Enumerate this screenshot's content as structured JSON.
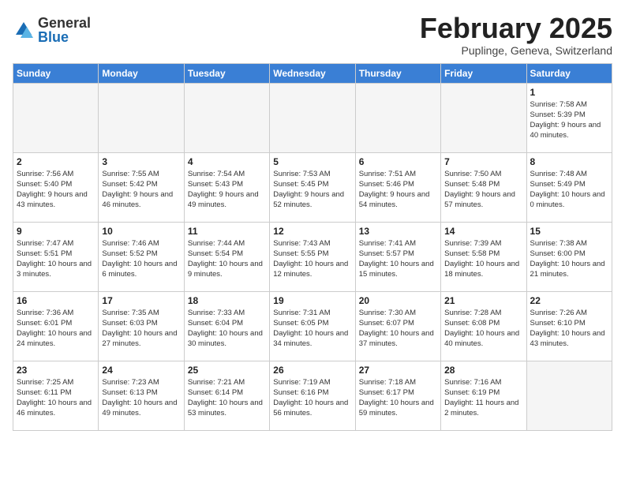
{
  "header": {
    "logo_general": "General",
    "logo_blue": "Blue",
    "month_title": "February 2025",
    "location": "Puplinge, Geneva, Switzerland"
  },
  "weekdays": [
    "Sunday",
    "Monday",
    "Tuesday",
    "Wednesday",
    "Thursday",
    "Friday",
    "Saturday"
  ],
  "weeks": [
    [
      {
        "day": "",
        "info": ""
      },
      {
        "day": "",
        "info": ""
      },
      {
        "day": "",
        "info": ""
      },
      {
        "day": "",
        "info": ""
      },
      {
        "day": "",
        "info": ""
      },
      {
        "day": "",
        "info": ""
      },
      {
        "day": "1",
        "info": "Sunrise: 7:58 AM\nSunset: 5:39 PM\nDaylight: 9 hours and 40 minutes."
      }
    ],
    [
      {
        "day": "2",
        "info": "Sunrise: 7:56 AM\nSunset: 5:40 PM\nDaylight: 9 hours and 43 minutes."
      },
      {
        "day": "3",
        "info": "Sunrise: 7:55 AM\nSunset: 5:42 PM\nDaylight: 9 hours and 46 minutes."
      },
      {
        "day": "4",
        "info": "Sunrise: 7:54 AM\nSunset: 5:43 PM\nDaylight: 9 hours and 49 minutes."
      },
      {
        "day": "5",
        "info": "Sunrise: 7:53 AM\nSunset: 5:45 PM\nDaylight: 9 hours and 52 minutes."
      },
      {
        "day": "6",
        "info": "Sunrise: 7:51 AM\nSunset: 5:46 PM\nDaylight: 9 hours and 54 minutes."
      },
      {
        "day": "7",
        "info": "Sunrise: 7:50 AM\nSunset: 5:48 PM\nDaylight: 9 hours and 57 minutes."
      },
      {
        "day": "8",
        "info": "Sunrise: 7:48 AM\nSunset: 5:49 PM\nDaylight: 10 hours and 0 minutes."
      }
    ],
    [
      {
        "day": "9",
        "info": "Sunrise: 7:47 AM\nSunset: 5:51 PM\nDaylight: 10 hours and 3 minutes."
      },
      {
        "day": "10",
        "info": "Sunrise: 7:46 AM\nSunset: 5:52 PM\nDaylight: 10 hours and 6 minutes."
      },
      {
        "day": "11",
        "info": "Sunrise: 7:44 AM\nSunset: 5:54 PM\nDaylight: 10 hours and 9 minutes."
      },
      {
        "day": "12",
        "info": "Sunrise: 7:43 AM\nSunset: 5:55 PM\nDaylight: 10 hours and 12 minutes."
      },
      {
        "day": "13",
        "info": "Sunrise: 7:41 AM\nSunset: 5:57 PM\nDaylight: 10 hours and 15 minutes."
      },
      {
        "day": "14",
        "info": "Sunrise: 7:39 AM\nSunset: 5:58 PM\nDaylight: 10 hours and 18 minutes."
      },
      {
        "day": "15",
        "info": "Sunrise: 7:38 AM\nSunset: 6:00 PM\nDaylight: 10 hours and 21 minutes."
      }
    ],
    [
      {
        "day": "16",
        "info": "Sunrise: 7:36 AM\nSunset: 6:01 PM\nDaylight: 10 hours and 24 minutes."
      },
      {
        "day": "17",
        "info": "Sunrise: 7:35 AM\nSunset: 6:03 PM\nDaylight: 10 hours and 27 minutes."
      },
      {
        "day": "18",
        "info": "Sunrise: 7:33 AM\nSunset: 6:04 PM\nDaylight: 10 hours and 30 minutes."
      },
      {
        "day": "19",
        "info": "Sunrise: 7:31 AM\nSunset: 6:05 PM\nDaylight: 10 hours and 34 minutes."
      },
      {
        "day": "20",
        "info": "Sunrise: 7:30 AM\nSunset: 6:07 PM\nDaylight: 10 hours and 37 minutes."
      },
      {
        "day": "21",
        "info": "Sunrise: 7:28 AM\nSunset: 6:08 PM\nDaylight: 10 hours and 40 minutes."
      },
      {
        "day": "22",
        "info": "Sunrise: 7:26 AM\nSunset: 6:10 PM\nDaylight: 10 hours and 43 minutes."
      }
    ],
    [
      {
        "day": "23",
        "info": "Sunrise: 7:25 AM\nSunset: 6:11 PM\nDaylight: 10 hours and 46 minutes."
      },
      {
        "day": "24",
        "info": "Sunrise: 7:23 AM\nSunset: 6:13 PM\nDaylight: 10 hours and 49 minutes."
      },
      {
        "day": "25",
        "info": "Sunrise: 7:21 AM\nSunset: 6:14 PM\nDaylight: 10 hours and 53 minutes."
      },
      {
        "day": "26",
        "info": "Sunrise: 7:19 AM\nSunset: 6:16 PM\nDaylight: 10 hours and 56 minutes."
      },
      {
        "day": "27",
        "info": "Sunrise: 7:18 AM\nSunset: 6:17 PM\nDaylight: 10 hours and 59 minutes."
      },
      {
        "day": "28",
        "info": "Sunrise: 7:16 AM\nSunset: 6:19 PM\nDaylight: 11 hours and 2 minutes."
      },
      {
        "day": "",
        "info": ""
      }
    ]
  ]
}
